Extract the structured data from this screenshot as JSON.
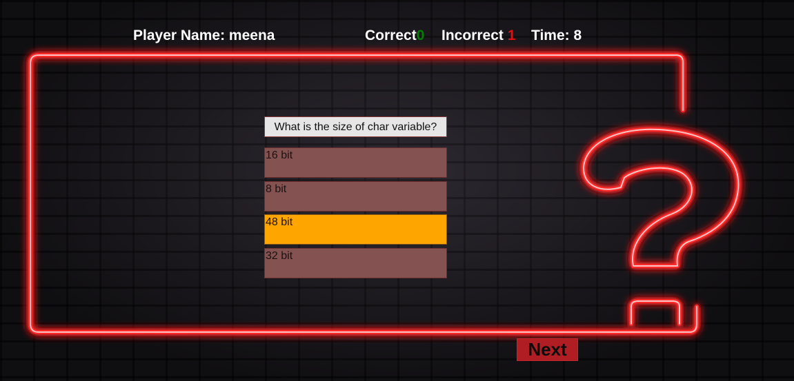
{
  "hud": {
    "player_label": "Player Name:",
    "player_name": "meena",
    "correct_label": "Correct",
    "correct_value": "0",
    "incorrect_label": "Incorrect",
    "incorrect_value": "1",
    "time_label": "Time:",
    "time_value": "8"
  },
  "quiz": {
    "question": "What is the size of char variable?",
    "options": [
      "16 bit",
      "8 bit",
      "48 bit",
      "32 bit"
    ],
    "selected_option": "48 bit"
  },
  "controls": {
    "next_label": "Next"
  },
  "colors": {
    "neon": "#ff2a2a",
    "option_bg": "#855252",
    "selected_bg": "#ffa500",
    "correct_value": "#008000",
    "incorrect_value": "#e01010",
    "next_bg": "#b01e24"
  }
}
